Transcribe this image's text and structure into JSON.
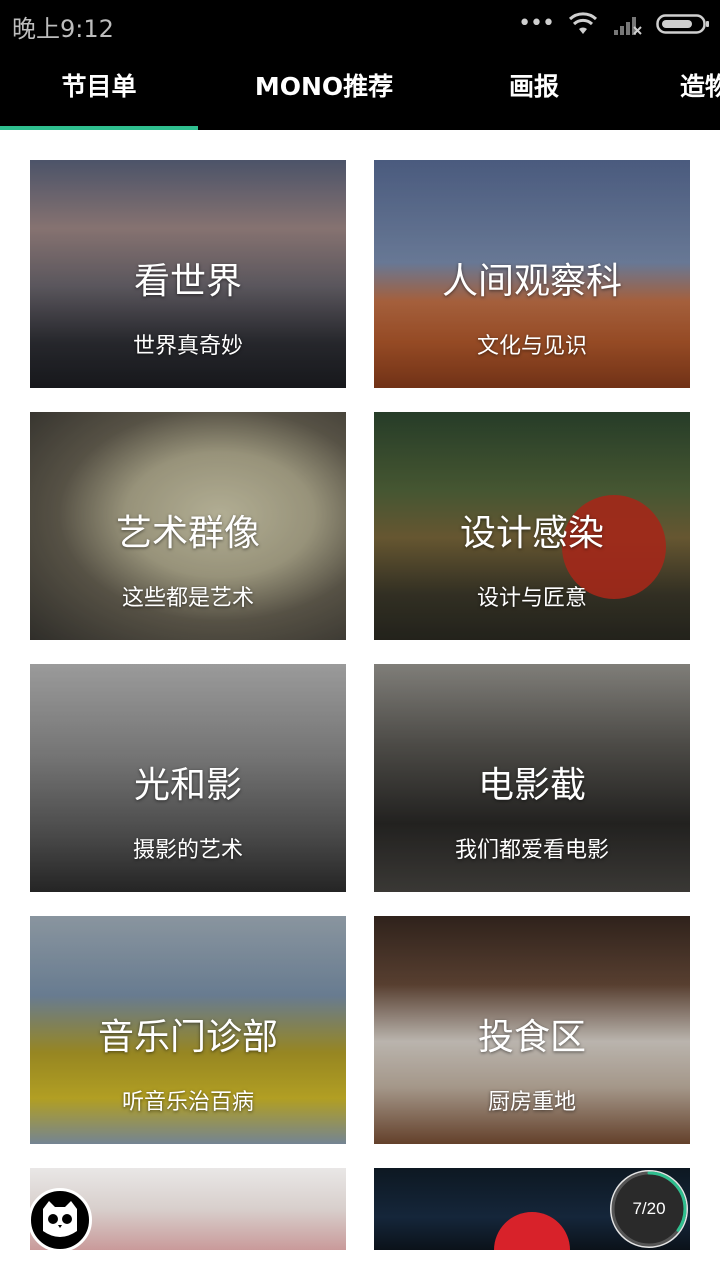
{
  "status_bar": {
    "time": "晚上9:12",
    "icons": [
      "more-dots-icon",
      "wifi-icon",
      "signal-no-service-icon",
      "battery-icon"
    ]
  },
  "tabs": [
    {
      "label": "节目单",
      "selected": true
    },
    {
      "label": "MONO推荐",
      "selected": false
    },
    {
      "label": "画报",
      "selected": false
    },
    {
      "label": "造物",
      "selected": false
    }
  ],
  "colors": {
    "accent": "#2fbf8f",
    "header_bg": "#000000",
    "page_bg": "#ffffff"
  },
  "cards": [
    {
      "title": "看世界",
      "subtitle": "世界真奇妙"
    },
    {
      "title": "人间观察科",
      "subtitle": "文化与见识"
    },
    {
      "title": "艺术群像",
      "subtitle": "这些都是艺术"
    },
    {
      "title": "设计感染",
      "subtitle": "设计与匠意"
    },
    {
      "title": "光和影",
      "subtitle": "摄影的艺术"
    },
    {
      "title": "电影截",
      "subtitle": "我们都爱看电影"
    },
    {
      "title": "音乐门诊部",
      "subtitle": "听音乐治百病"
    },
    {
      "title": "投食区",
      "subtitle": "厨房重地"
    },
    {
      "title": "",
      "subtitle": ""
    },
    {
      "title": "",
      "subtitle": ""
    }
  ],
  "progress": {
    "text": "7/20",
    "current": 7,
    "total": 20
  },
  "avatar": {
    "icon": "owl-avatar-icon"
  }
}
